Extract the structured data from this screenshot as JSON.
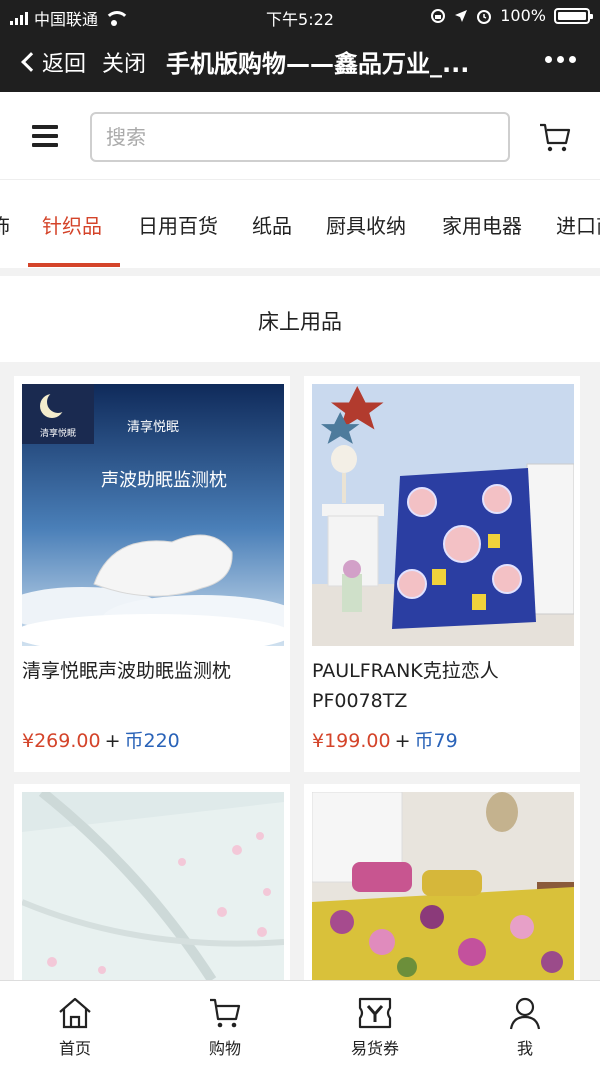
{
  "status_bar": {
    "carrier": "中国联通",
    "time": "下午5:22",
    "battery": "100%"
  },
  "title_bar": {
    "back_label": "返回",
    "close_label": "关闭",
    "title": "手机版购物——鑫品万业_..."
  },
  "search": {
    "placeholder": "搜索"
  },
  "tabs": [
    {
      "label": "饰"
    },
    {
      "label": "针织品"
    },
    {
      "label": "日用百货"
    },
    {
      "label": "纸品"
    },
    {
      "label": "厨具收纳"
    },
    {
      "label": "家用电器"
    },
    {
      "label": "进口商"
    }
  ],
  "section": {
    "title": "床上用品"
  },
  "products": [
    {
      "name": "清享悦眠声波助眠监测枕",
      "price": "¥269.00",
      "coins": "币220",
      "image_brand": "清享悦眠",
      "image_overlay_title": "清享悦眠",
      "image_overlay_sub": "声波助眠监测枕"
    },
    {
      "name": "PAULFRANK克拉恋人PF0078TZ",
      "price": "¥199.00",
      "coins": "币79"
    },
    {
      "name": "",
      "price": "",
      "coins": ""
    },
    {
      "name": "",
      "price": "",
      "coins": ""
    }
  ],
  "price_plus": "+",
  "bottom_nav": [
    {
      "label": "首页",
      "icon": "home-icon"
    },
    {
      "label": "购物",
      "icon": "cart-icon"
    },
    {
      "label": "易货券",
      "icon": "voucher-icon"
    },
    {
      "label": "我",
      "icon": "user-icon"
    }
  ],
  "colors": {
    "accent": "#d4442a",
    "coin": "#2a63b8",
    "topbar": "#1f1f1f"
  }
}
